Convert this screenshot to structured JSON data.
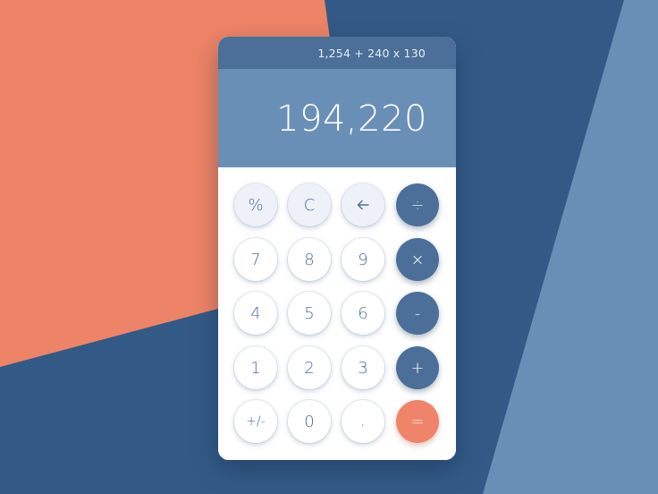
{
  "calculator": {
    "expression": "1,254 + 240 x 130",
    "result": "194,220"
  },
  "keys": {
    "percent": "%",
    "clear": "C",
    "backspace_icon": "arrow-left-icon",
    "divide": "÷",
    "seven": "7",
    "eight": "8",
    "nine": "9",
    "multiply": "×",
    "four": "4",
    "five": "5",
    "six": "6",
    "minus": "-",
    "one": "1",
    "two": "2",
    "three": "3",
    "plus": "+",
    "plus_minus": "+/-",
    "zero": "0",
    "comma": ",",
    "equals": "="
  },
  "colors": {
    "background_navy": "#335a86",
    "background_coral": "#ee8467",
    "background_light_blue": "#6a8fb7",
    "expression_bar": "#4b6f98",
    "result_panel": "#6a8fb7",
    "operator_key": "#4b6f98",
    "equals_key": "#ef846a",
    "light_key": "#eef2f8"
  }
}
